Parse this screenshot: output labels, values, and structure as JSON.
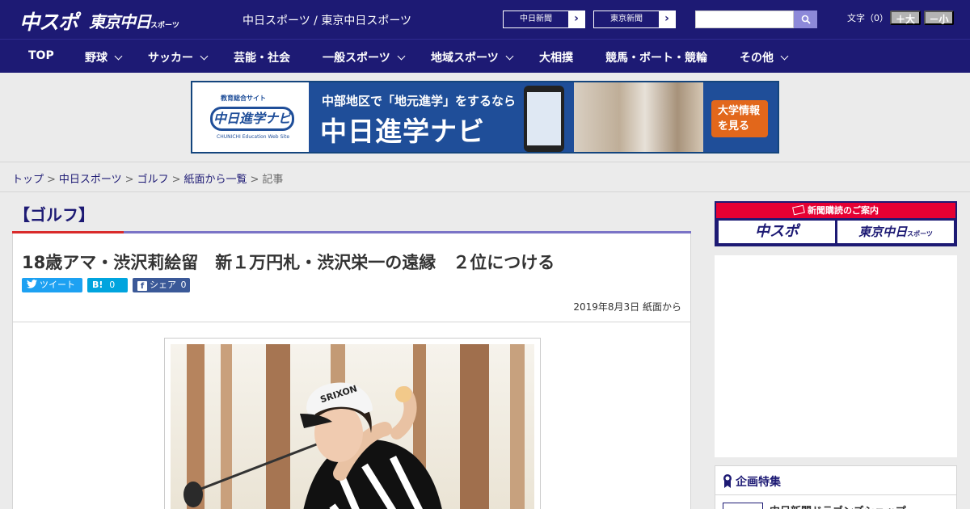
{
  "header": {
    "logo_chuspo": "中スポ",
    "logo_tokyo": "東京中日",
    "logo_tokyo_suffix": "スポーツ",
    "site_title": "中日スポーツ / 東京中日スポーツ",
    "news_links": [
      "中日新聞",
      "東京新聞"
    ],
    "search_placeholder": "",
    "font_size_label": "文字（0）",
    "font_bigger": "＋大",
    "font_smaller": "－小"
  },
  "nav": {
    "items": [
      "TOP",
      "野球",
      "サッカー",
      "芸能・社会",
      "一般スポーツ",
      "地域スポーツ",
      "大相撲",
      "競馬・ボート・競輪",
      "その他"
    ]
  },
  "ad": {
    "logo_sub": "教育総合サイト",
    "logo_main": "中日進学ナビ",
    "logo_en": "CHUNICHI Education Web Site",
    "headline": "中部地区で「地元進学」をするなら",
    "title": "中日進学ナビ",
    "cta_line1": "大学情報",
    "cta_line2": "を見る"
  },
  "breadcrumb": {
    "items": [
      "トップ",
      "中日スポーツ",
      "ゴルフ",
      "紙面から一覧"
    ],
    "current": "記事",
    "separator": ">"
  },
  "article": {
    "category": "【ゴルフ】",
    "headline": "18歳アマ・渋沢莉絵留　新１万円札・渋沢栄一の遠縁　２位につける",
    "share_tweet": "ツイート",
    "share_hatena": "B!",
    "share_hatena_count": "0",
    "share_facebook": "シェア",
    "share_facebook_count": "0",
    "date": "2019年8月3日 紙面から",
    "cap_brand": "SRIXON"
  },
  "sidebar": {
    "subscription_head": "新聞購読のご案内",
    "sub_logo_1": "中スポ",
    "sub_logo_2": "東京中日",
    "sub_logo_2_suffix": "スポーツ",
    "feature_title": "企画特集",
    "feature_item": "中日新聞ドラゴンズショップ"
  },
  "colors": {
    "brand_navy": "#1d1a74",
    "accent_red": "#d92b2b",
    "accent_purple": "#7b74c7",
    "twitter": "#1da1f2",
    "hatena": "#00a4de",
    "facebook": "#3b5998",
    "cta_orange": "#e2671b"
  }
}
